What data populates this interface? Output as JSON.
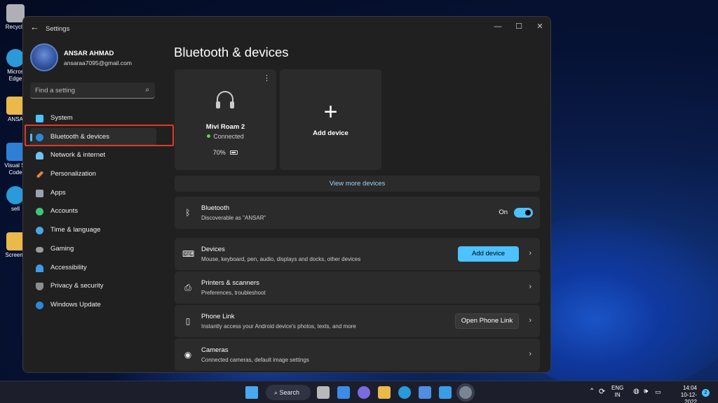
{
  "desktop": {
    "icons": [
      {
        "label": "Recycle",
        "color": "#d9d9d9"
      },
      {
        "label": "Micros Edge",
        "color": "#2a9ad8"
      },
      {
        "label": "ANSA",
        "color": "#e9b94a"
      },
      {
        "label": "Visual St Code",
        "color": "#2f7fd6"
      },
      {
        "label": "sell",
        "color": "#2a9ad8"
      },
      {
        "label": "Screens",
        "color": "#e9b94a"
      }
    ]
  },
  "window": {
    "title": "Settings",
    "controls": {
      "minimize": "—",
      "maximize": "☐",
      "close": "✕"
    },
    "back_glyph": "←"
  },
  "profile": {
    "name": "ANSAR AHMAD",
    "email": "ansaraa7095@gmail.com"
  },
  "search": {
    "placeholder": "Find a setting",
    "icon": "search-icon"
  },
  "nav": {
    "items": [
      {
        "label": "System",
        "icon": "system-icon",
        "color": "#4cc2ff"
      },
      {
        "label": "Bluetooth & devices",
        "icon": "bluetooth-icon",
        "color": "#2b88d8",
        "active": true
      },
      {
        "label": "Network & internet",
        "icon": "wifi-icon",
        "color": "#6fc3f0"
      },
      {
        "label": "Personalization",
        "icon": "brush-icon",
        "color": "#e3823b"
      },
      {
        "label": "Apps",
        "icon": "apps-icon",
        "color": "#9aa3ad"
      },
      {
        "label": "Accounts",
        "icon": "account-icon",
        "color": "#3ec57a"
      },
      {
        "label": "Time & language",
        "icon": "globe-icon",
        "color": "#49a6e8"
      },
      {
        "label": "Gaming",
        "icon": "gaming-icon",
        "color": "#9a9a9a"
      },
      {
        "label": "Accessibility",
        "icon": "accessibility-icon",
        "color": "#3d9be9"
      },
      {
        "label": "Privacy & security",
        "icon": "shield-icon",
        "color": "#8d8d8d"
      },
      {
        "label": "Windows Update",
        "icon": "update-icon",
        "color": "#2b88d8"
      }
    ]
  },
  "main": {
    "title": "Bluetooth & devices",
    "device_card": {
      "name": "Mivi Roam 2",
      "status": "Connected",
      "battery": "70%",
      "icon": "headphones-icon"
    },
    "add_card": {
      "label": "Add device",
      "glyph": "+"
    },
    "view_more": "View more devices",
    "bluetooth": {
      "title": "Bluetooth",
      "subtitle": "Discoverable as \"ANSAR\"",
      "toggle_label": "On"
    },
    "rows": [
      {
        "title": "Devices",
        "subtitle": "Mouse, keyboard, pen, audio, displays and docks, other devices",
        "icon": "devices-icon",
        "button": "Add device"
      },
      {
        "title": "Printers & scanners",
        "subtitle": "Preferences, troubleshoot",
        "icon": "printer-icon"
      },
      {
        "title": "Phone Link",
        "subtitle": "Instantly access your Android device's photos, texts, and more",
        "icon": "phone-icon",
        "button": "Open Phone Link"
      },
      {
        "title": "Cameras",
        "subtitle": "Connected cameras, default image settings",
        "icon": "camera-icon"
      }
    ]
  },
  "taskbar": {
    "search_label": "Search",
    "language": {
      "line1": "ENG",
      "line2": "IN"
    },
    "clock": {
      "time": "14:04",
      "date": "10-12-2022"
    },
    "notifications": "2"
  }
}
